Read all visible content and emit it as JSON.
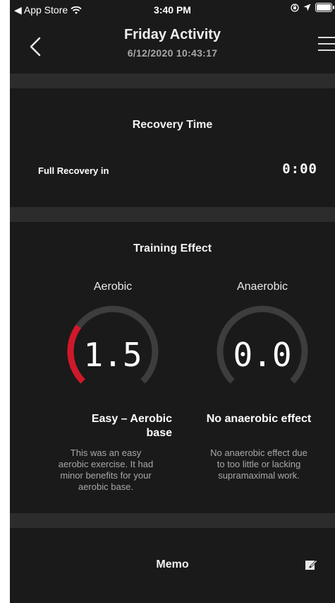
{
  "status_bar": {
    "back_app": "◀ App Store",
    "time": "3:40 PM"
  },
  "nav": {
    "title": "Friday Activity",
    "subtitle": "6/12/2020 10:43:17"
  },
  "recovery": {
    "section_title": "Recovery Time",
    "label": "Full Recovery in",
    "value": "0:00"
  },
  "training_effect": {
    "section_title": "Training Effect",
    "aerobic": {
      "heading": "Aerobic",
      "value": "1.5",
      "level_fraction": 0.3,
      "title_line1": "Easy – Aerobic",
      "title_line2": "base",
      "desc_line1": "This was an easy",
      "desc_line2": "aerobic exercise. It had",
      "desc_line3": "minor benefits for your",
      "desc_line4": "aerobic base.",
      "accent": "#d0182a"
    },
    "anaerobic": {
      "heading": "Anaerobic",
      "value": "0.0",
      "level_fraction": 0.0,
      "title": "No anaerobic effect",
      "desc_line1": "No anaerobic effect due",
      "desc_line2": "to too little or lacking",
      "desc_line3": "supramaximal work."
    }
  },
  "memo": {
    "label": "Memo"
  },
  "icons": {
    "back": "chevron-left-icon",
    "menu": "hamburger-menu-icon",
    "edit": "edit-note-icon",
    "wifi": "wifi-icon",
    "location": "location-arrow-icon",
    "orientation_lock": "orientation-lock-icon",
    "battery": "battery-icon"
  },
  "colors": {
    "background": "#1a1a1a",
    "band": "#2c2c2c",
    "gauge_track": "#3d3d3d",
    "gauge_active": "#d0182a"
  }
}
